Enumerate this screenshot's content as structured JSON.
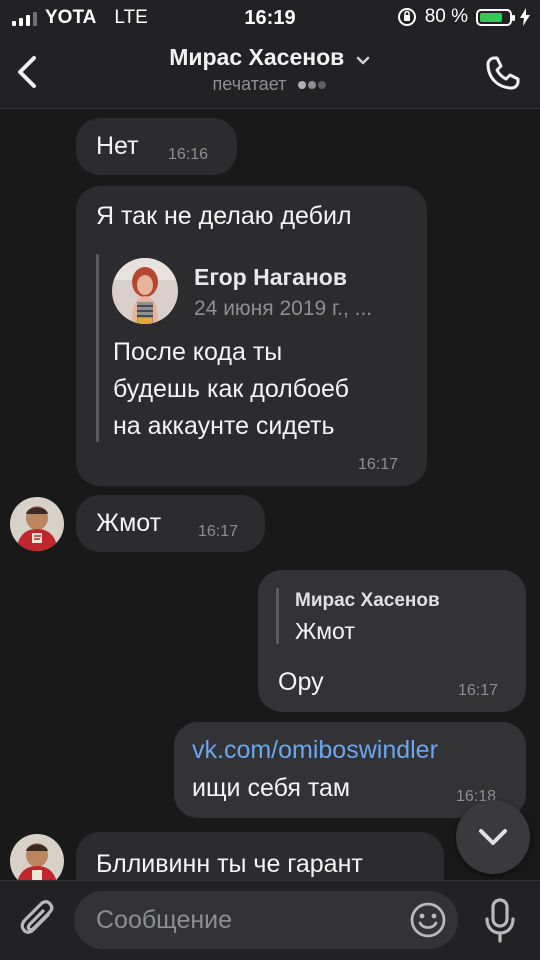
{
  "status_bar": {
    "carrier": "YOTA",
    "network": "LTE",
    "time": "16:19",
    "battery": "80 %",
    "battery_level": 0.8
  },
  "header": {
    "contact_name": "Мирас Хасенов",
    "status": "печатает"
  },
  "messages": [
    {
      "text": "Нет",
      "time": "16:16"
    },
    {
      "text": "Я так не делаю дебил",
      "forward": {
        "author": "Егор Наганов",
        "date": "24 июня 2019 г., ...",
        "lines": [
          "После кода ты",
          "будешь как долбоеб",
          "на аккаунте сидеть"
        ]
      },
      "time": "16:17"
    },
    {
      "text": "Жмот",
      "time": "16:17"
    },
    {
      "reply": {
        "author": "Мирас Хасенов",
        "text": "Жмот"
      },
      "text": "Ору",
      "time": "16:17"
    },
    {
      "link": "vk.com/omiboswindler",
      "text": "ищи себя там",
      "time": "16:18"
    },
    {
      "text": "Блливинн ты че гарант"
    }
  ],
  "composer": {
    "placeholder": "Сообщение"
  },
  "colors": {
    "background": "#19191a",
    "bubble_in": "#2c2c2e",
    "bubble_out": "#333336",
    "link": "#6aa6f1",
    "battery": "#35c759"
  },
  "icons": [
    "back-chevron-icon",
    "chevron-down-icon",
    "phone-icon",
    "attach-paperclip-icon",
    "emoji-icon",
    "microphone-icon",
    "scroll-down-chevron-icon",
    "do-not-disturb-icon",
    "charging-bolt-icon"
  ]
}
